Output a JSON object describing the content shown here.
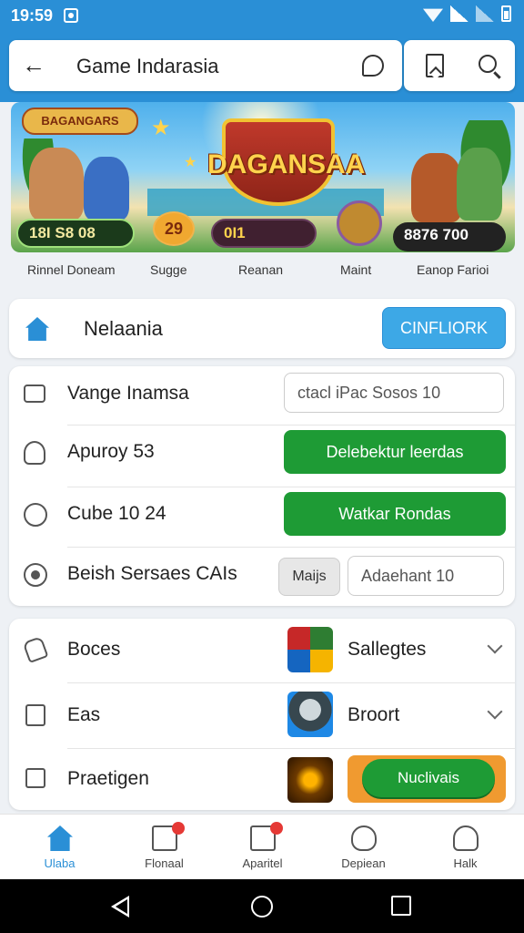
{
  "status_bar": {
    "time": "19:59"
  },
  "header": {
    "title": "Game Indarasia"
  },
  "banner": {
    "logo_text": "BAGANGARS",
    "main_title": "DAGANSAA",
    "pill_left": "18I S8 08",
    "pill_badge": "29",
    "pill_center": "0I1",
    "pill_right": "8876 700"
  },
  "banner_captions": [
    "Rinnel Doneam",
    "Sugge",
    "Reanan",
    "Maint",
    "Eanop Farioi"
  ],
  "section": {
    "label": "Nelaania",
    "button": "CINFLIORK"
  },
  "list": [
    {
      "label": "Vange Inamsa",
      "button": "ctacl iPac Sosos 10",
      "style": "outline"
    },
    {
      "label": "Apuroy 53",
      "button": "Delebektur leerdas",
      "style": "green"
    },
    {
      "label": "Cube 10 24",
      "button": "Watkar Rondas",
      "style": "green"
    },
    {
      "label": "Beish Sersaes CAIs",
      "chip": "Maijs",
      "button": "Adaehant 10",
      "style": "outline"
    }
  ],
  "games": [
    {
      "label": "Boces",
      "title": "Sallegtes"
    },
    {
      "label": "Eas",
      "title": "Broort"
    },
    {
      "label": "Praetigen",
      "button": "Nuclivais"
    }
  ],
  "bottom_nav": [
    {
      "label": "Ulaba"
    },
    {
      "label": "Flonaal"
    },
    {
      "label": "Aparitel"
    },
    {
      "label": "Depiean"
    },
    {
      "label": "Halk"
    }
  ]
}
